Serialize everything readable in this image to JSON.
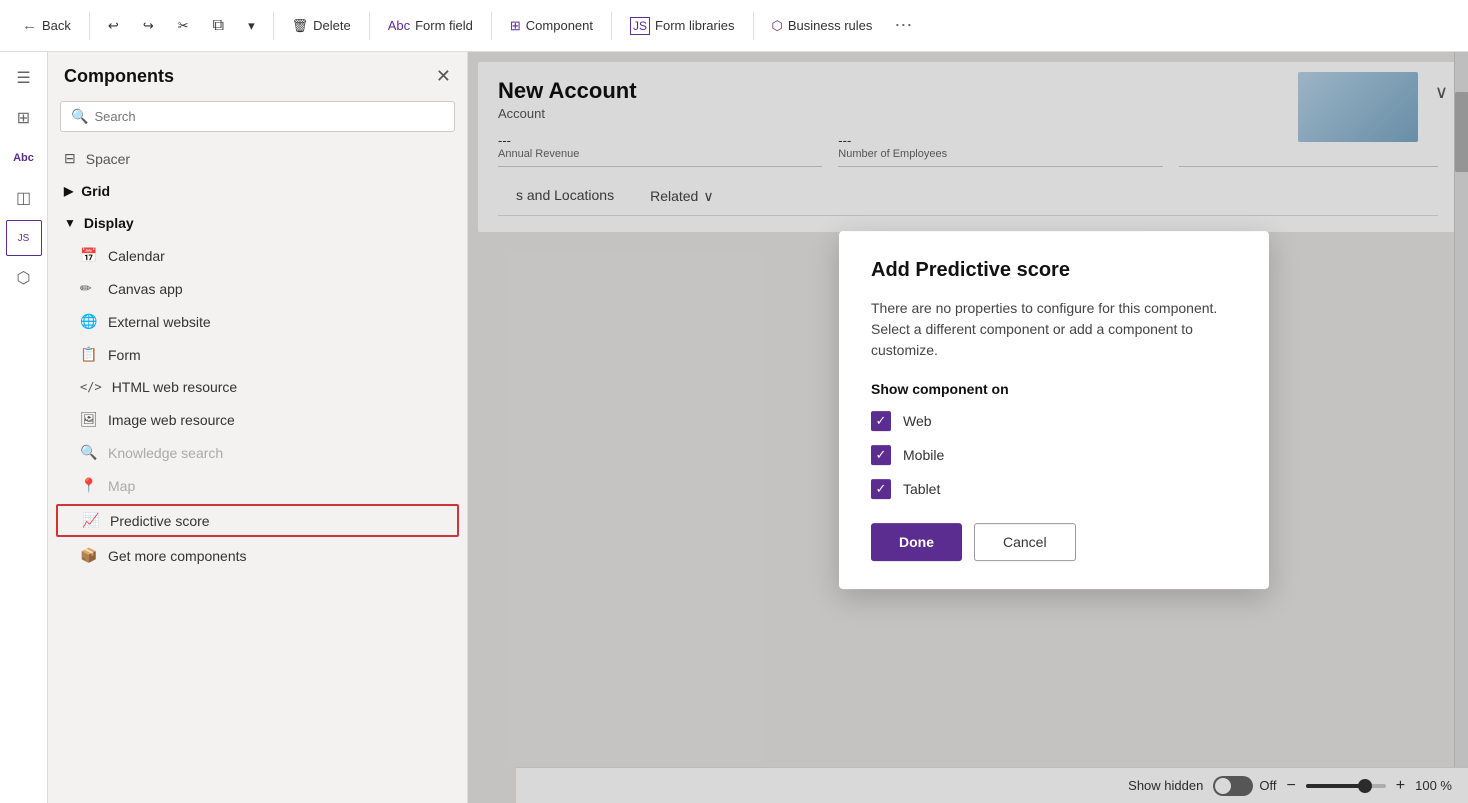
{
  "toolbar": {
    "back_label": "Back",
    "undo_icon": "↩",
    "redo_icon": "↪",
    "cut_icon": "✂",
    "copy_icon": "⧉",
    "dropdown_icon": "▾",
    "delete_label": "Delete",
    "form_field_label": "Form field",
    "component_label": "Component",
    "form_libraries_label": "Form libraries",
    "business_rules_label": "Business rules",
    "more_icon": "⋯"
  },
  "left_nav": {
    "items": [
      {
        "name": "hamburger-menu",
        "icon": "☰"
      },
      {
        "name": "grid-view",
        "icon": "⊞"
      },
      {
        "name": "text-field",
        "icon": "Abc"
      },
      {
        "name": "layers",
        "icon": "⊛"
      },
      {
        "name": "code",
        "icon": "JS"
      },
      {
        "name": "connector",
        "icon": "⬡"
      }
    ]
  },
  "sidebar": {
    "title": "Components",
    "search_placeholder": "Search",
    "close_icon": "✕",
    "items": [
      {
        "name": "spacer",
        "label": "Spacer",
        "icon": "⊟",
        "type": "spacer"
      },
      {
        "name": "grid-section",
        "label": "Grid",
        "icon": "▶",
        "type": "section-header",
        "expanded": false
      },
      {
        "name": "display-section",
        "label": "Display",
        "icon": "▼",
        "type": "section-header",
        "expanded": true
      },
      {
        "name": "calendar",
        "label": "Calendar",
        "icon": "📅",
        "type": "item"
      },
      {
        "name": "canvas-app",
        "label": "Canvas app",
        "icon": "✏",
        "type": "item"
      },
      {
        "name": "external-website",
        "label": "External website",
        "icon": "🌐",
        "type": "item"
      },
      {
        "name": "form",
        "label": "Form",
        "icon": "📋",
        "type": "item"
      },
      {
        "name": "html-web-resource",
        "label": "HTML web resource",
        "icon": "</>",
        "type": "item"
      },
      {
        "name": "image-web-resource",
        "label": "Image web resource",
        "icon": "🖼",
        "type": "item"
      },
      {
        "name": "knowledge-search",
        "label": "Knowledge search",
        "icon": "🔍",
        "type": "item",
        "disabled": true
      },
      {
        "name": "map",
        "label": "Map",
        "icon": "📍",
        "type": "item",
        "disabled": true
      },
      {
        "name": "predictive-score",
        "label": "Predictive score",
        "icon": "📈",
        "type": "item",
        "highlighted": true
      },
      {
        "name": "get-more-components",
        "label": "Get more components",
        "icon": "📦",
        "type": "item"
      }
    ]
  },
  "form_preview": {
    "title": "New Account",
    "subtitle": "Account",
    "field1_value": "---",
    "field1_label": "Annual Revenue",
    "field2_value": "---",
    "field2_label": "Number of Employees",
    "tabs": [
      {
        "label": "s and Locations"
      },
      {
        "label": "Related",
        "has_dropdown": true
      }
    ]
  },
  "modal": {
    "title": "Add Predictive score",
    "description": "There are no properties to configure for this component. Select a different component or add a component to customize.",
    "show_component_on_label": "Show component on",
    "checkboxes": [
      {
        "label": "Web",
        "checked": true
      },
      {
        "label": "Mobile",
        "checked": true
      },
      {
        "label": "Tablet",
        "checked": true
      }
    ],
    "done_button": "Done",
    "cancel_button": "Cancel"
  },
  "bottom_bar": {
    "show_hidden_label": "Show hidden",
    "toggle_state": "Off",
    "minus_icon": "−",
    "plus_icon": "+",
    "zoom_level": "100 %"
  }
}
